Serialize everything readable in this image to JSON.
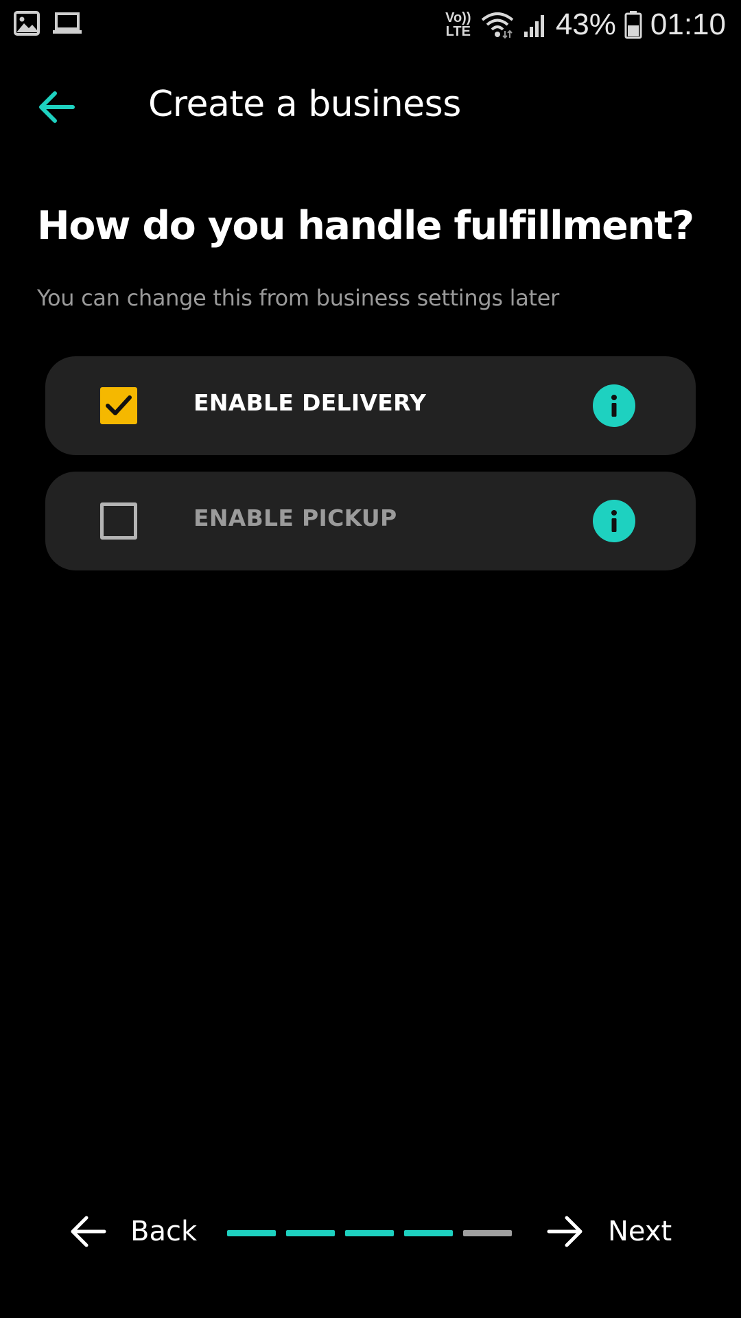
{
  "status_bar": {
    "network_label_top": "Vo))",
    "network_label_bottom": "LTE",
    "battery_text": "43%",
    "time": "01:10"
  },
  "header": {
    "title": "Create a business"
  },
  "question": {
    "title": "How do you handle fulfillment?",
    "subtitle": "You can change this from business settings later"
  },
  "options": [
    {
      "label": "ENABLE DELIVERY",
      "checked": true
    },
    {
      "label": "ENABLE PICKUP",
      "checked": false
    }
  ],
  "nav": {
    "back_label": "Back",
    "next_label": "Next",
    "steps_total": 5,
    "steps_completed": 4
  },
  "colors": {
    "accent": "#1ed1c0",
    "checkbox_checked": "#f5b800",
    "card_background": "#222222",
    "progress_inactive": "#a0a0a0"
  }
}
